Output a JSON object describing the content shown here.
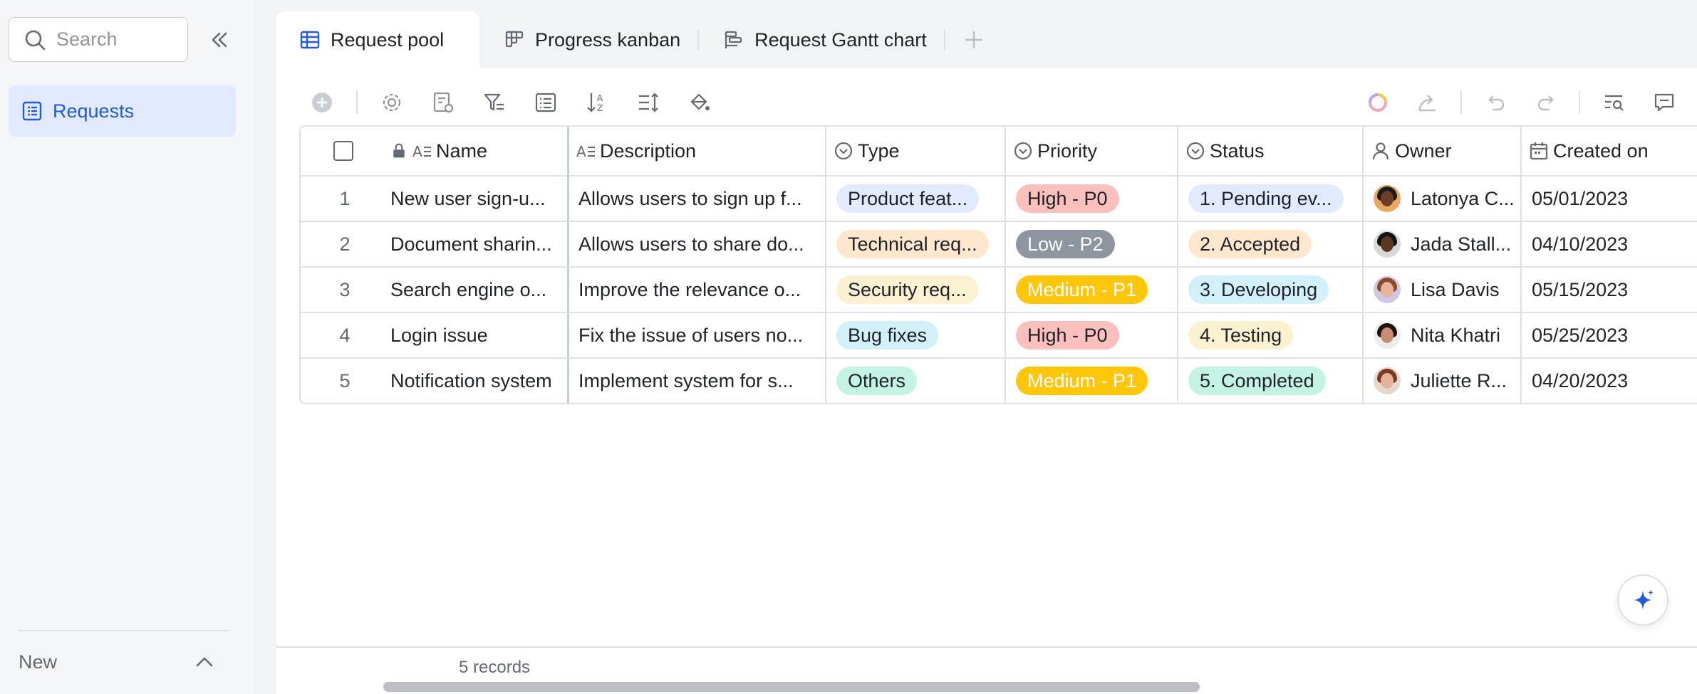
{
  "sidebar": {
    "search_placeholder": "Search",
    "items": [
      {
        "label": "Requests",
        "icon": "table-icon"
      }
    ],
    "new_label": "New"
  },
  "tabs": [
    {
      "label": "Request pool",
      "icon": "grid-view-icon",
      "active": true
    },
    {
      "label": "Progress kanban",
      "icon": "kanban-icon",
      "active": false
    },
    {
      "label": "Request Gantt chart",
      "icon": "gantt-icon",
      "active": false
    }
  ],
  "table": {
    "columns": [
      "Name",
      "Description",
      "Type",
      "Priority",
      "Status",
      "Owner",
      "Created on"
    ],
    "rows": [
      {
        "num": "1",
        "name": "New user sign-u...",
        "description": "Allows users to sign up f...",
        "type": {
          "label": "Product feat...",
          "bg": "#e1eaff"
        },
        "priority": {
          "label": "High - P0",
          "bg": "#fbbfbc",
          "fg": "#1f2329"
        },
        "status": {
          "label": "1. Pending ev...",
          "bg": "#e1eaff"
        },
        "owner": {
          "name": "Latonya C...",
          "skin": "#6b3f26",
          "hair": "#1b1b1b",
          "bg": "#e9a85e"
        },
        "created": "05/01/2023"
      },
      {
        "num": "2",
        "name": "Document sharin...",
        "description": "Allows users to share do...",
        "type": {
          "label": "Technical req...",
          "bg": "#fee7cd"
        },
        "priority": {
          "label": "Low - P2",
          "bg": "#8f959e",
          "fg": "#ffffff"
        },
        "status": {
          "label": "2. Accepted",
          "bg": "#fee7cd"
        },
        "owner": {
          "name": "Jada Stall...",
          "skin": "#5a3623",
          "hair": "#141414",
          "bg": "#d8d8d8"
        },
        "created": "04/10/2023"
      },
      {
        "num": "3",
        "name": "Search engine o...",
        "description": "Improve the relevance o...",
        "type": {
          "label": "Security req...",
          "bg": "#faf1d1"
        },
        "priority": {
          "label": "Medium - P1",
          "bg": "#ffc60a",
          "fg": "#ffffff"
        },
        "status": {
          "label": "3. Developing",
          "bg": "#d1f0f7"
        },
        "owner": {
          "name": "Lisa Davis",
          "skin": "#e8b59a",
          "hair": "#8a4a2b",
          "bg": "#cfc7e4"
        },
        "created": "05/15/2023"
      },
      {
        "num": "4",
        "name": "Login issue",
        "description": "Fix the issue of users no...",
        "type": {
          "label": "Bug fixes",
          "bg": "#d1f0f7"
        },
        "priority": {
          "label": "High - P0",
          "bg": "#fbbfbc",
          "fg": "#1f2329"
        },
        "status": {
          "label": "4. Testing",
          "bg": "#faf1d1"
        },
        "owner": {
          "name": "Nita Khatri",
          "skin": "#c98c6e",
          "hair": "#1e1210",
          "bg": "#ececec"
        },
        "created": "05/25/2023"
      },
      {
        "num": "5",
        "name": "Notification system",
        "description": "Implement system for s...",
        "type": {
          "label": "Others",
          "bg": "#c4f2e5"
        },
        "priority": {
          "label": "Medium - P1",
          "bg": "#ffc60a",
          "fg": "#ffffff"
        },
        "status": {
          "label": "5. Completed",
          "bg": "#c4f2e5"
        },
        "owner": {
          "name": "Juliette R...",
          "skin": "#e6b39a",
          "hair": "#7a3b22",
          "bg": "#e8d8cc"
        },
        "created": "04/20/2023"
      }
    ]
  },
  "footer": {
    "records": "5 records"
  }
}
